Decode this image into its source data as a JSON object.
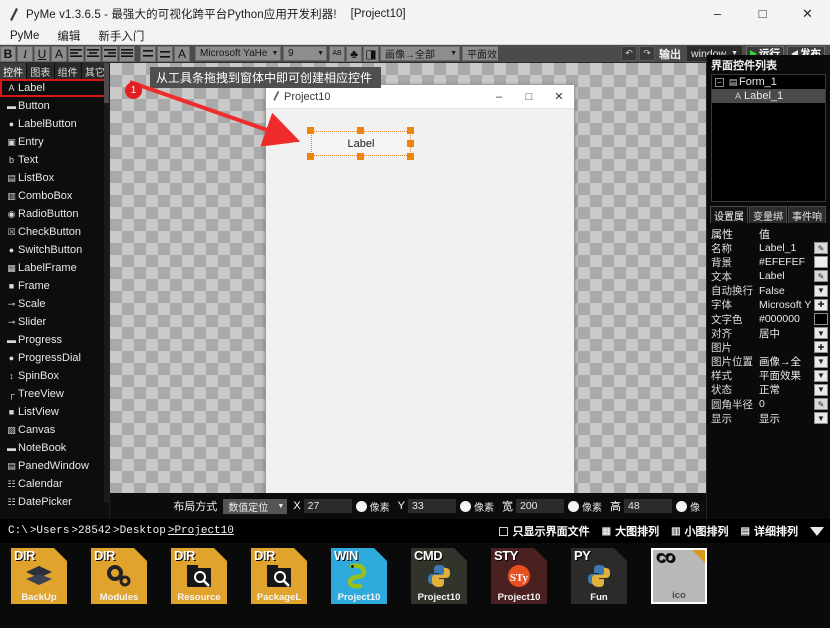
{
  "titlebar": {
    "title": "PyMe v1.3.6.5 -  最强大的可视化跨平台Python应用开发利器!",
    "project": "[Project10]",
    "minimize": "–",
    "maximize": "□",
    "close": "✕"
  },
  "menubar": {
    "items": [
      "PyMe",
      "编辑",
      "新手入门"
    ]
  },
  "format_toolbar": {
    "bold": "B",
    "italic": "I",
    "underline": "U",
    "strike": "A",
    "align_left": "≡",
    "align_center": "≡",
    "align_right": "≡",
    "align_justify": "≡",
    "valign_mid": "☰",
    "valign_bottom": "☰",
    "font_color": "A",
    "font_family": "Microsoft YaHe",
    "font_size": "9",
    "btn_abc": "AB",
    "btn_fill": "♣",
    "btn_image": "◨",
    "image_mode": "画像→全部",
    "style_mode": "平面效",
    "icon_undo": "↶",
    "icon_redo": "↷",
    "output_label": "输出",
    "window_select": "window",
    "run_label": "运行",
    "publish_label": "发布"
  },
  "palette": {
    "tabs": [
      "控件",
      "图表",
      "组件",
      "其它"
    ],
    "active_tab": "控件",
    "items": [
      {
        "icon": "A",
        "label": "Label",
        "selected": true
      },
      {
        "icon": "▬",
        "label": "Button"
      },
      {
        "icon": "●",
        "label": "LabelButton"
      },
      {
        "icon": "▣",
        "label": "Entry"
      },
      {
        "icon": "὜b",
        "label": "Text"
      },
      {
        "icon": "▤",
        "label": "ListBox"
      },
      {
        "icon": "▥",
        "label": "ComboBox"
      },
      {
        "icon": "◉",
        "label": "RadioButton"
      },
      {
        "icon": "☒",
        "label": "CheckButton"
      },
      {
        "icon": "●",
        "label": "SwitchButton"
      },
      {
        "icon": "▦",
        "label": "LabelFrame"
      },
      {
        "icon": "■",
        "label": "Frame"
      },
      {
        "icon": "⊸",
        "label": "Scale"
      },
      {
        "icon": "⊸",
        "label": "Slider"
      },
      {
        "icon": "▬",
        "label": "Progress"
      },
      {
        "icon": "●",
        "label": "ProgressDial"
      },
      {
        "icon": "↕",
        "label": "SpinBox"
      },
      {
        "icon": "┌",
        "label": "TreeView"
      },
      {
        "icon": "■",
        "label": "ListView"
      },
      {
        "icon": "▧",
        "label": "Canvas"
      },
      {
        "icon": "▬",
        "label": "NoteBook"
      },
      {
        "icon": "▤",
        "label": "PanedWindow"
      },
      {
        "icon": "☷",
        "label": "Calendar"
      },
      {
        "icon": "☷",
        "label": "DatePicker"
      }
    ]
  },
  "canvas": {
    "callout_text": "从工具条拖拽到窗体中即可创建相应控件",
    "callout_badge": "1",
    "form": {
      "title": "Project10",
      "minimize": "–",
      "maximize": "□",
      "close": "✕",
      "label_text": "Label"
    }
  },
  "right_panel": {
    "title": "界面控件列表",
    "tree": [
      {
        "label": "Form_1",
        "expander": "−",
        "icon": "▤",
        "level": 0
      },
      {
        "label": "Label_1",
        "icon": "A",
        "level": 1,
        "selected": true
      }
    ],
    "tabs": [
      "设置属",
      "变量绑",
      "事件响"
    ],
    "active_tab": "设置属",
    "property_header": {
      "key": "属性",
      "value": "值"
    },
    "properties": [
      {
        "key": "名称",
        "value": "Label_1",
        "editor": "pencil"
      },
      {
        "key": "背景",
        "value": "#EFEFEF",
        "editor": "swatch",
        "color": "#EFEFEF"
      },
      {
        "key": "文本",
        "value": "Label",
        "editor": "pencil"
      },
      {
        "key": "自动换行",
        "value": "False",
        "editor": "dropdown"
      },
      {
        "key": "字体",
        "value": "Microsoft Y",
        "editor": "plus"
      },
      {
        "key": "文字色",
        "value": "#000000",
        "editor": "swatch",
        "color": "#000000"
      },
      {
        "key": "对齐",
        "value": "居中",
        "editor": "dropdown"
      },
      {
        "key": "图片",
        "value": "",
        "editor": "plus"
      },
      {
        "key": "图片位置",
        "value": "画像→全",
        "editor": "dropdown"
      },
      {
        "key": "样式",
        "value": "平面效果",
        "editor": "dropdown"
      },
      {
        "key": "状态",
        "value": "正常",
        "editor": "dropdown"
      },
      {
        "key": "圆角半径",
        "value": "0",
        "editor": "pencil"
      },
      {
        "key": "显示",
        "value": "显示",
        "editor": "dropdown"
      }
    ]
  },
  "layout_bar": {
    "label": "布局方式",
    "mode": "数值定位",
    "fields": [
      {
        "key": "X",
        "value": "27",
        "unit": "像素"
      },
      {
        "key": "Y",
        "value": "33",
        "unit": "像素"
      },
      {
        "key": "宽",
        "value": "200",
        "unit": "像素"
      },
      {
        "key": "高",
        "value": "48",
        "unit": "像"
      }
    ]
  },
  "path_bar": {
    "crumbs": [
      "C:\\",
      ">Users",
      ">28542",
      ">Desktop",
      ">Project10"
    ],
    "only_ui_files": "只显示界面文件",
    "view_large": "大图排列",
    "view_small": "小图排列",
    "view_detail": "详细排列"
  },
  "files": [
    {
      "tag": "DIR",
      "name": "BackUp",
      "glyph": "layers",
      "bg": "#e0a32e",
      "tagcolor": "#ffffff"
    },
    {
      "tag": "DIR",
      "name": "Modules",
      "glyph": "gears",
      "bg": "#e0a32e",
      "tagcolor": "#ffffff"
    },
    {
      "tag": "DIR",
      "name": "Resource",
      "glyph": "search",
      "bg": "#e0a32e",
      "tagcolor": "#ffffff"
    },
    {
      "tag": "DIR",
      "name": "PackageL",
      "glyph": "search",
      "bg": "#e0a32e",
      "tagcolor": "#ffffff"
    },
    {
      "tag": "WIN",
      "name": "Project10",
      "glyph": "snake",
      "bg": "#2eabdc",
      "tagcolor": "#ffffff"
    },
    {
      "tag": "CMD",
      "name": "Project10",
      "glyph": "python",
      "bg": "#31342a",
      "tagcolor": "#ffffff"
    },
    {
      "tag": "STY",
      "name": "Project10",
      "glyph": "sty",
      "bg": "#4a2020",
      "tagcolor": "#ffffff"
    },
    {
      "tag": "PY",
      "name": "Fun",
      "glyph": "python",
      "bg": "#2b2b2b",
      "tagcolor": "#ffffff"
    },
    {
      "tag": "CO",
      "name": "ico",
      "glyph": "blank",
      "bg": "#b8b8b8",
      "tagcolor": "#111111"
    }
  ]
}
